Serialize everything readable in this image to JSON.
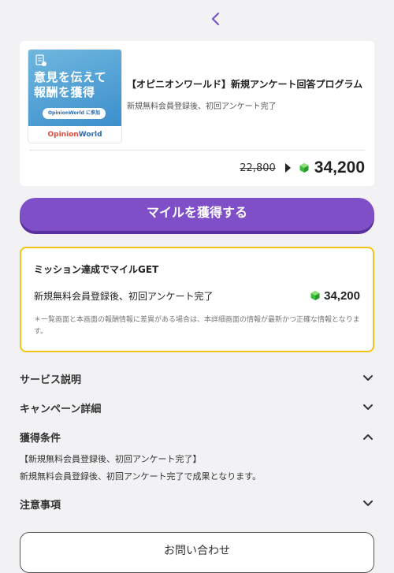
{
  "header": {
    "back_icon": "chevron-left-icon",
    "accent": "#7e4fc6"
  },
  "offer": {
    "thumbnail": {
      "headline_line1": "意見を伝えて",
      "headline_line2": "報酬を獲得",
      "pill_text": "OpinionWorld に参加",
      "logo_text_a": "Opinion",
      "logo_text_b": "World"
    },
    "title": "【オピニオンワールド】新規アンケート回答プログラム",
    "subtitle": "新規無料会員登録後、初回アンケート完了",
    "old_price": "22,800",
    "new_price": "34,200",
    "gem_icon": "green-gem-icon"
  },
  "cta": {
    "label": "マイルを獲得する",
    "color": "#7e4fc6"
  },
  "mission": {
    "title": "ミッション達成でマイルGET",
    "condition": "新規無料会員登録後、初回アンケート完了",
    "points": "34,200",
    "note": "＊一覧画面と本画面の報酬情報に差異がある場合は、本詳細画面の情報が最新かつ正確な情報となります。",
    "border_color": "#f0c419"
  },
  "sections": {
    "service": "サービス説明",
    "campaign": "キャンペーン詳細",
    "conditions": "獲得条件",
    "notes": "注意事項"
  },
  "conditions": {
    "line1": "【新規無料会員登録後、初回アンケート完了】",
    "line2": "新規無料会員登録後、初回アンケート完了で成果となります。"
  },
  "inquiry": {
    "label": "お問い合わせ"
  }
}
